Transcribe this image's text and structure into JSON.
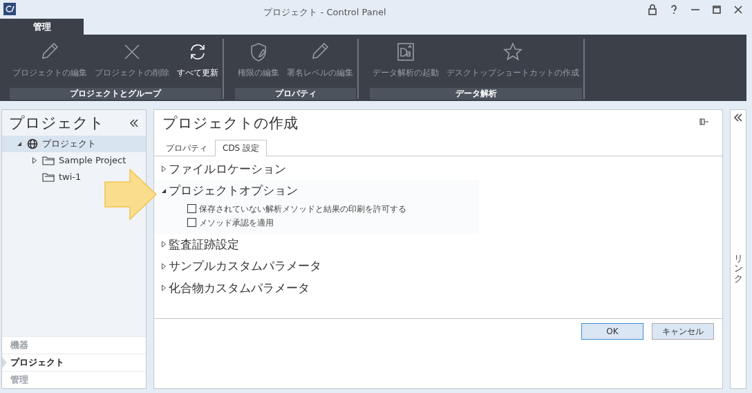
{
  "window": {
    "title": "プロジェクト - Control Panel"
  },
  "ribbon": {
    "tabs": [
      {
        "label": "管理",
        "selected": true
      }
    ],
    "groups": [
      {
        "label": "プロジェクトとグループ",
        "buttons": [
          {
            "label": "プロジェクトの編集",
            "kind": "pencil",
            "disabled": true
          },
          {
            "label": "プロジェクトの削除",
            "kind": "cross",
            "disabled": true
          },
          {
            "label": "すべて更新",
            "kind": "refresh",
            "disabled": false
          }
        ]
      },
      {
        "label": "プロパティ",
        "buttons": [
          {
            "label": "権限の編集",
            "kind": "shield",
            "disabled": true
          },
          {
            "label": "署名レベルの編集",
            "kind": "pencil",
            "disabled": true
          }
        ]
      },
      {
        "label": "データ解析",
        "buttons": [
          {
            "label": "データ解析の起動",
            "kind": "document",
            "disabled": true
          },
          {
            "label": "デスクトップショートカットの作成",
            "kind": "star",
            "disabled": true
          }
        ]
      }
    ]
  },
  "sidebar": {
    "title": "プロジェクト",
    "tree": [
      {
        "label": "プロジェクト",
        "kind": "globe",
        "expanded": true,
        "selected": true,
        "children": [
          {
            "label": "Sample Project",
            "kind": "folder",
            "expanded": false,
            "selected": false
          },
          {
            "label": "twi-1",
            "kind": "folder",
            "selected": false
          }
        ]
      }
    ],
    "nav": [
      {
        "label": "機器",
        "selected": false
      },
      {
        "label": "プロジェクト",
        "selected": true
      },
      {
        "label": "管理",
        "selected": false
      }
    ]
  },
  "main": {
    "title": "プロジェクトの作成",
    "tabs": [
      {
        "label": "プロパティ",
        "selected": false
      },
      {
        "label": "CDS 設定",
        "selected": true
      }
    ],
    "sections": [
      {
        "title": "ファイルロケーション",
        "expanded": false
      },
      {
        "title": "プロジェクトオプション",
        "expanded": true,
        "options": [
          {
            "label": "保存されていない解析メソッドと結果の印刷を許可する",
            "checked": false
          },
          {
            "label": "メソッド承認を適用",
            "checked": false
          }
        ]
      },
      {
        "title": "監査証跡設定",
        "expanded": false
      },
      {
        "title": "サンプルカスタムパラメータ",
        "expanded": false
      },
      {
        "title": "化合物カスタムパラメータ",
        "expanded": false
      }
    ],
    "buttons": [
      {
        "label": "OK",
        "kind": "default"
      },
      {
        "label": "キャンセル",
        "kind": "normal"
      }
    ]
  },
  "right_panel": {
    "label": "リンク"
  }
}
